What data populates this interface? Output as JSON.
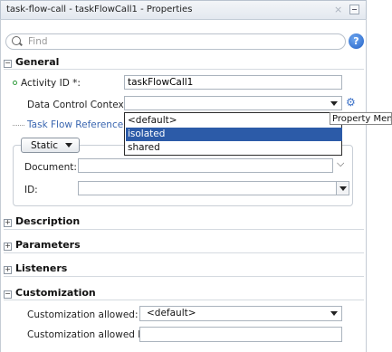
{
  "window": {
    "title": "task-flow-call - taskFlowCall1 - Properties",
    "close_glyph": "×"
  },
  "search": {
    "placeholder": "Find",
    "help_label": "?"
  },
  "sections": {
    "general": {
      "label": "General",
      "toggle": "−",
      "activity_id_label": "Activity ID *:",
      "activity_id_value": "taskFlowCall1",
      "data_control_label": "Data Control Context:",
      "data_control_value": "",
      "task_flow_reference_label": "Task Flow Reference",
      "mode_button_label": "Static",
      "document_label": "Document:",
      "document_value": "",
      "id_label": "ID:",
      "id_value": ""
    },
    "description": {
      "label": "Description",
      "toggle": "+"
    },
    "parameters": {
      "label": "Parameters",
      "toggle": "+"
    },
    "listeners": {
      "label": "Listeners",
      "toggle": "+"
    },
    "customization": {
      "label": "Customization",
      "toggle": "−",
      "allowed_label": "Customization allowed:",
      "allowed_value": "<default>",
      "allowed_by_label": "Customization allowed by:",
      "allowed_by_value": ""
    }
  },
  "dropdown": {
    "options": [
      "<default>",
      "isolated",
      "shared"
    ],
    "highlighted": "isolated"
  },
  "tooltip": {
    "text": "Property Menu"
  },
  "colors": {
    "accent": "#2c5ba8",
    "link": "#3a66b0",
    "required": "#2e9a3a"
  }
}
